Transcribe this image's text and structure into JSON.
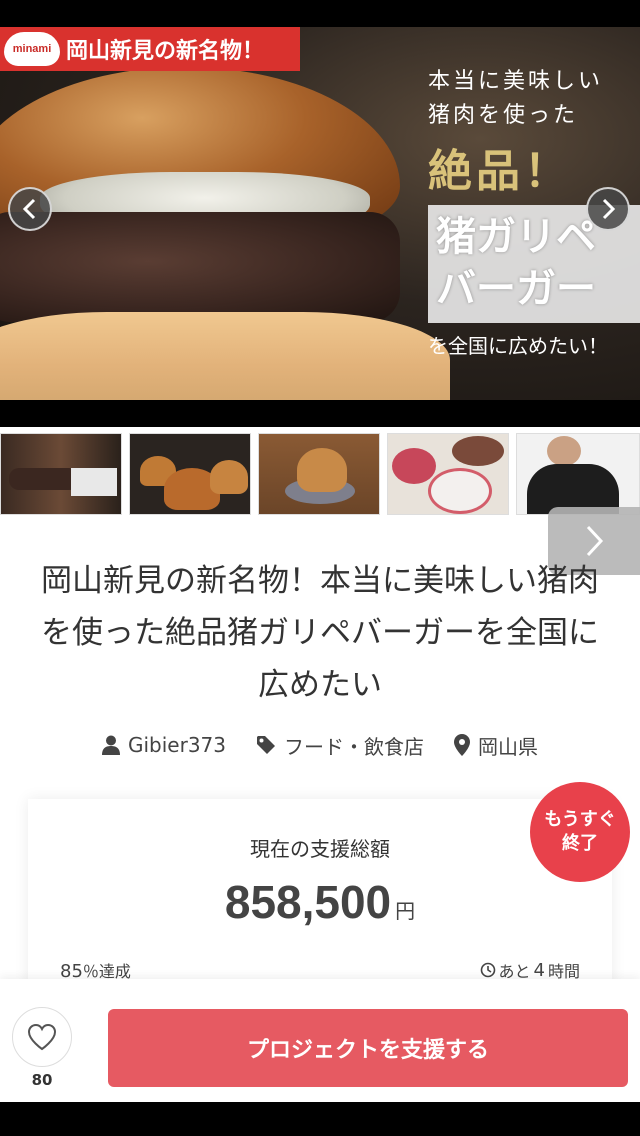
{
  "hero": {
    "brand_logo": "minami",
    "brand_title": "岡山新見の新名物！",
    "copy_line1": "本当に美味しい",
    "copy_line2": "猪肉を使った",
    "copy_highlight": "絶品！",
    "copy_box": "猪ガリペ\nバーガー",
    "copy_tail": "を全国に広めたい！",
    "prev_icon": "chevron-left-icon",
    "next_icon": "chevron-right-icon"
  },
  "thumbnails": [
    {
      "name": "thumb-burger-ad"
    },
    {
      "name": "thumb-burgers-group"
    },
    {
      "name": "thumb-burger-plate"
    },
    {
      "name": "thumb-meat-platters"
    },
    {
      "name": "thumb-chef"
    }
  ],
  "project": {
    "title": "岡山新見の新名物！本当に美味しい猪肉を使った絶品猪ガリペバーガーを全国に広めたい",
    "owner": "Gibier373",
    "category": "フード・飲食店",
    "location": "岡山県"
  },
  "funding": {
    "label": "現在の支援総額",
    "amount": "858,500",
    "currency": "円",
    "percent": "85",
    "percent_suffix": "％達成",
    "remaining_prefix": "あと",
    "remaining_value": "4",
    "remaining_unit": "時間",
    "badge": "もうすぐ終了"
  },
  "actions": {
    "like_count": "80",
    "support_label": "プロジェクトを支援する"
  },
  "colors": {
    "accent": "#e65a62",
    "badge": "#e8414b",
    "brand_red": "#d9322e"
  }
}
